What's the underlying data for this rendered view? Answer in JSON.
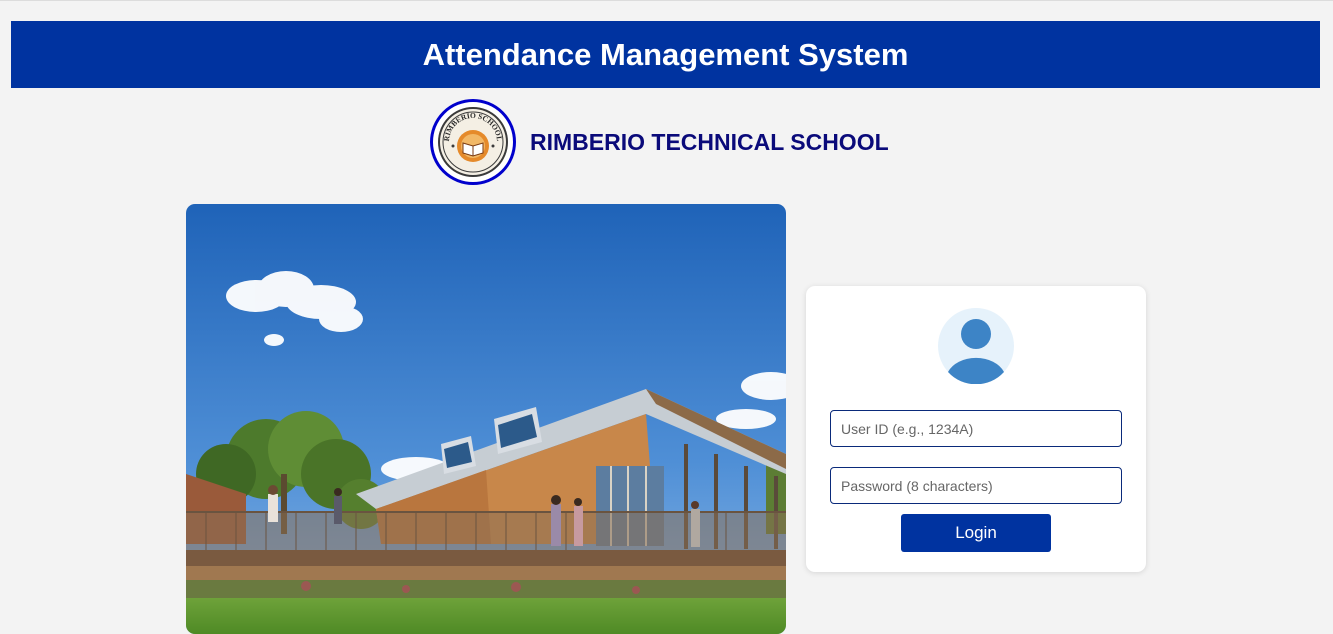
{
  "header": {
    "title": "Attendance Management System"
  },
  "brand": {
    "school_name": "RIMBERIO TECHNICAL SCHOOL",
    "logo_text": "RIMBERIO SCHOOL",
    "logo_icon": "open-book-seal-icon"
  },
  "photo": {
    "subject": "school-building-photo"
  },
  "login": {
    "avatar_icon": "user-avatar-icon",
    "userid_placeholder": "User ID (e.g., 1234A)",
    "password_placeholder": "Password (8 characters)",
    "button_label": "Login"
  },
  "colors": {
    "brand_blue": "#0033a0",
    "school_name": "#0a0a7a",
    "background": "#f3f3f3",
    "avatar_blue": "#3d84c6",
    "avatar_bg": "#e6f2fb"
  }
}
